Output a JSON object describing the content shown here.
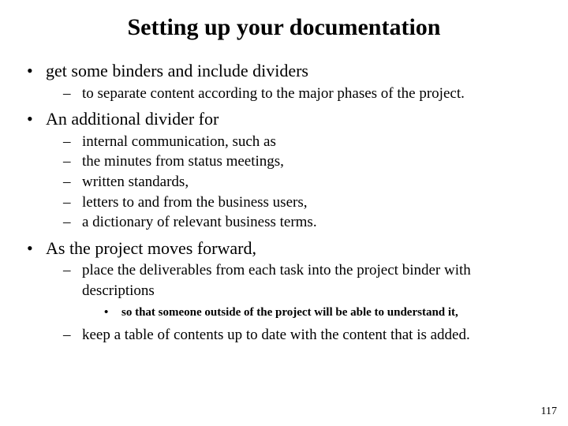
{
  "title": "Setting up your documentation",
  "bullets": [
    {
      "text": "get some binders and include dividers",
      "sub": [
        {
          "text": "to separate content according to the major phases of the project."
        }
      ]
    },
    {
      "text": "An additional divider for",
      "sub": [
        {
          "text": "internal communication, such as"
        },
        {
          "text": "the minutes from status meetings,"
        },
        {
          "text": "written standards,"
        },
        {
          "text": "letters to and from the business users,"
        },
        {
          "text": "a dictionary of relevant business terms."
        }
      ]
    },
    {
      "text": "As the project moves forward,",
      "sub": [
        {
          "text": "place the deliverables from each task into the project binder with descriptions",
          "sub": [
            {
              "text": "so that someone outside of the project will be able to understand it,"
            }
          ]
        },
        {
          "text": "keep a table of contents up to date with the content that is added."
        }
      ]
    }
  ],
  "page_number": "117"
}
